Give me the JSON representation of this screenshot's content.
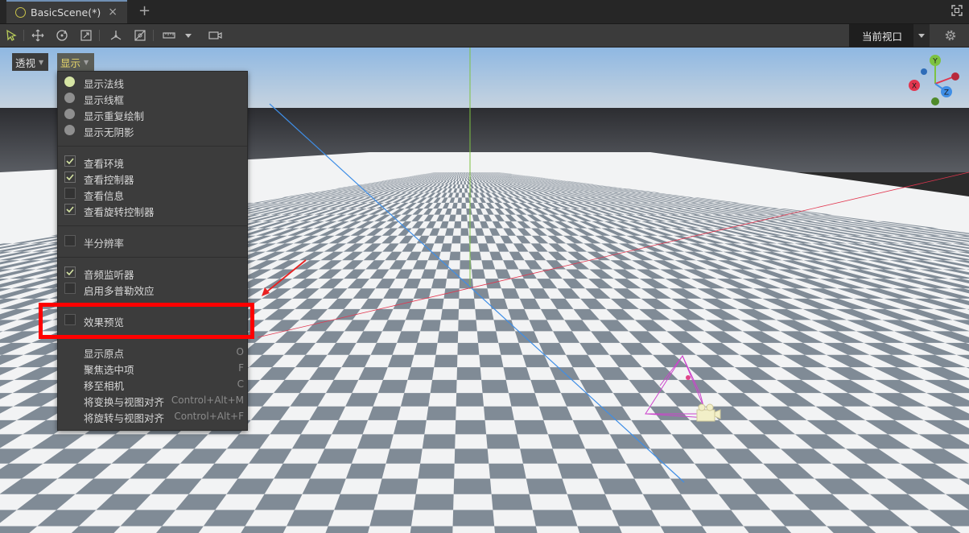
{
  "tab": {
    "title": "BasicScene(*)",
    "close": "×",
    "new": "+"
  },
  "toolbar": {
    "viewport_select": "当前视口"
  },
  "icons": {
    "scene": "scene-circle-icon",
    "select": "select-arrow-icon",
    "move": "move-icon",
    "rotate": "rotate-icon",
    "scale": "scale-icon",
    "pivot": "pivot-icon",
    "rect": "rect-transform-icon",
    "ruler": "ruler-icon",
    "camera": "camera-icon",
    "gear": "gear-icon",
    "fullscreen": "fullscreen-icon"
  },
  "view_buttons": {
    "perspective": "透视",
    "display": "显示"
  },
  "menu": {
    "radio_items": [
      {
        "label": "显示法线",
        "selected": true
      },
      {
        "label": "显示线框",
        "selected": false
      },
      {
        "label": "显示重复绘制",
        "selected": false
      },
      {
        "label": "显示无阴影",
        "selected": false
      }
    ],
    "view_items": [
      {
        "label": "查看环境",
        "checked": true
      },
      {
        "label": "查看控制器",
        "checked": true
      },
      {
        "label": "查看信息",
        "checked": false
      },
      {
        "label": "查看旋转控制器",
        "checked": true
      }
    ],
    "half_res": {
      "label": "半分辨率",
      "checked": false
    },
    "audio_items": [
      {
        "label": "音频监听器",
        "checked": true
      },
      {
        "label": "启用多普勒效应",
        "checked": false
      }
    ],
    "effect_preview": {
      "label": "效果预览",
      "checked": false
    },
    "actions": [
      {
        "label": "显示原点",
        "shortcut": "O"
      },
      {
        "label": "聚焦选中项",
        "shortcut": "F"
      },
      {
        "label": "移至相机",
        "shortcut": "C"
      },
      {
        "label": "将变换与视图对齐",
        "shortcut": "Control+Alt+M"
      },
      {
        "label": "将旋转与视图对齐",
        "shortcut": "Control+Alt+F"
      }
    ]
  },
  "gizmo": {
    "x": "X",
    "y": "Y",
    "z": "Z"
  },
  "colors": {
    "accent": "#6f8fb3",
    "highlight": "#ff0000",
    "axis_x": "#e2364f",
    "axis_y": "#7dc242",
    "axis_z": "#3f8ee6"
  }
}
